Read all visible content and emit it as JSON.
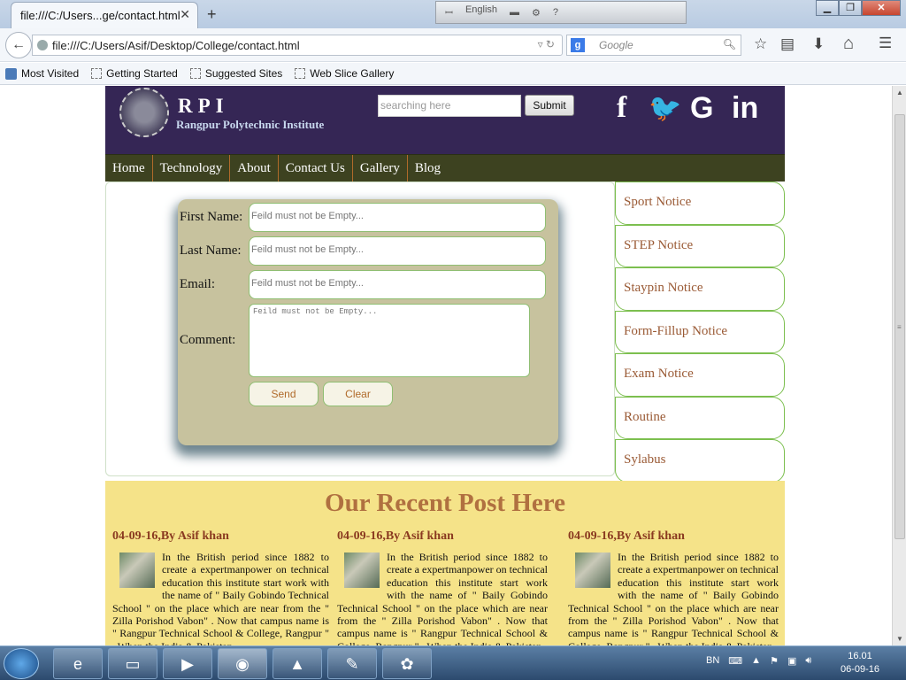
{
  "browser": {
    "tab_title": "file:///C:/Users...ge/contact.html",
    "tab_close": "✕",
    "new_tab": "+",
    "ime_lang": "English",
    "url": "file:///C:/Users/Asif/Desktop/College/contact.html",
    "search_engine_letter": "g",
    "search_placeholder": "Google",
    "window_controls": {
      "minimize": "▁",
      "maximize": "❐",
      "close": "✕"
    },
    "toolbar_icons": {
      "bookmark_star": "☆",
      "clipboard": "▤",
      "download": "⬇",
      "home": "⌂",
      "menu": "☰"
    },
    "bookmarks": [
      "Most Visited",
      "Getting Started",
      "Suggested Sites",
      "Web Slice Gallery"
    ]
  },
  "site": {
    "brand": "RPI",
    "brand_sub": "Rangpur Polytechnic Institute",
    "search_placeholder": "searching here",
    "submit": "Submit",
    "social": {
      "facebook": "f",
      "twitter": "🐦",
      "google": "G",
      "linkedin": "in"
    },
    "menu": [
      "Home",
      "Technology",
      "About",
      "Contact Us",
      "Gallery",
      "Blog"
    ],
    "form": {
      "first_name_label": "First Name:",
      "last_name_label": "Last Name:",
      "email_label": "Email:",
      "comment_label": "Comment:",
      "input_placeholder": "Feild must not be Empty...",
      "send": "Send",
      "clear": "Clear"
    },
    "notices": [
      "Sport Notice",
      "STEP Notice",
      "Staypin Notice",
      "Form-Fillup Notice",
      "Exam Notice",
      "Routine",
      "Sylabus"
    ],
    "posts_title": "Our Recent Post Here",
    "posts": [
      {
        "date": "04-09-16,By Asif khan",
        "body": "In the British period since 1882 to create a expertmanpower on technical education this institute start work with the name of \" Baily Gobindo Technical School \" on the place which are near from the \" Zilla Porishod Vabon\" . Now that campus name is \" Rangpur Technical School & College, Rangpur \" . When the India & Pakistan"
      },
      {
        "date": "04-09-16,By Asif khan",
        "body": "In the British period since 1882 to create a expertmanpower on technical education this institute start work with the name of \" Baily Gobindo Technical School \" on the place which are near from the \" Zilla Porishod Vabon\" . Now that campus name is \" Rangpur Technical School & College, Rangpur \" . When the India & Pakistan"
      },
      {
        "date": "04-09-16,By Asif khan",
        "body": "In the British period since 1882 to create a expertmanpower on technical education this institute start work with the name of \" Baily Gobindo Technical School \" on the place which are near from the \" Zilla Porishod Vabon\" . Now that campus name is \" Rangpur Technical School & College, Rangpur \" . When the India & Pakistan"
      }
    ]
  },
  "taskbar": {
    "tray_lang": "BN",
    "time": "16.01",
    "date": "06-09-16"
  }
}
